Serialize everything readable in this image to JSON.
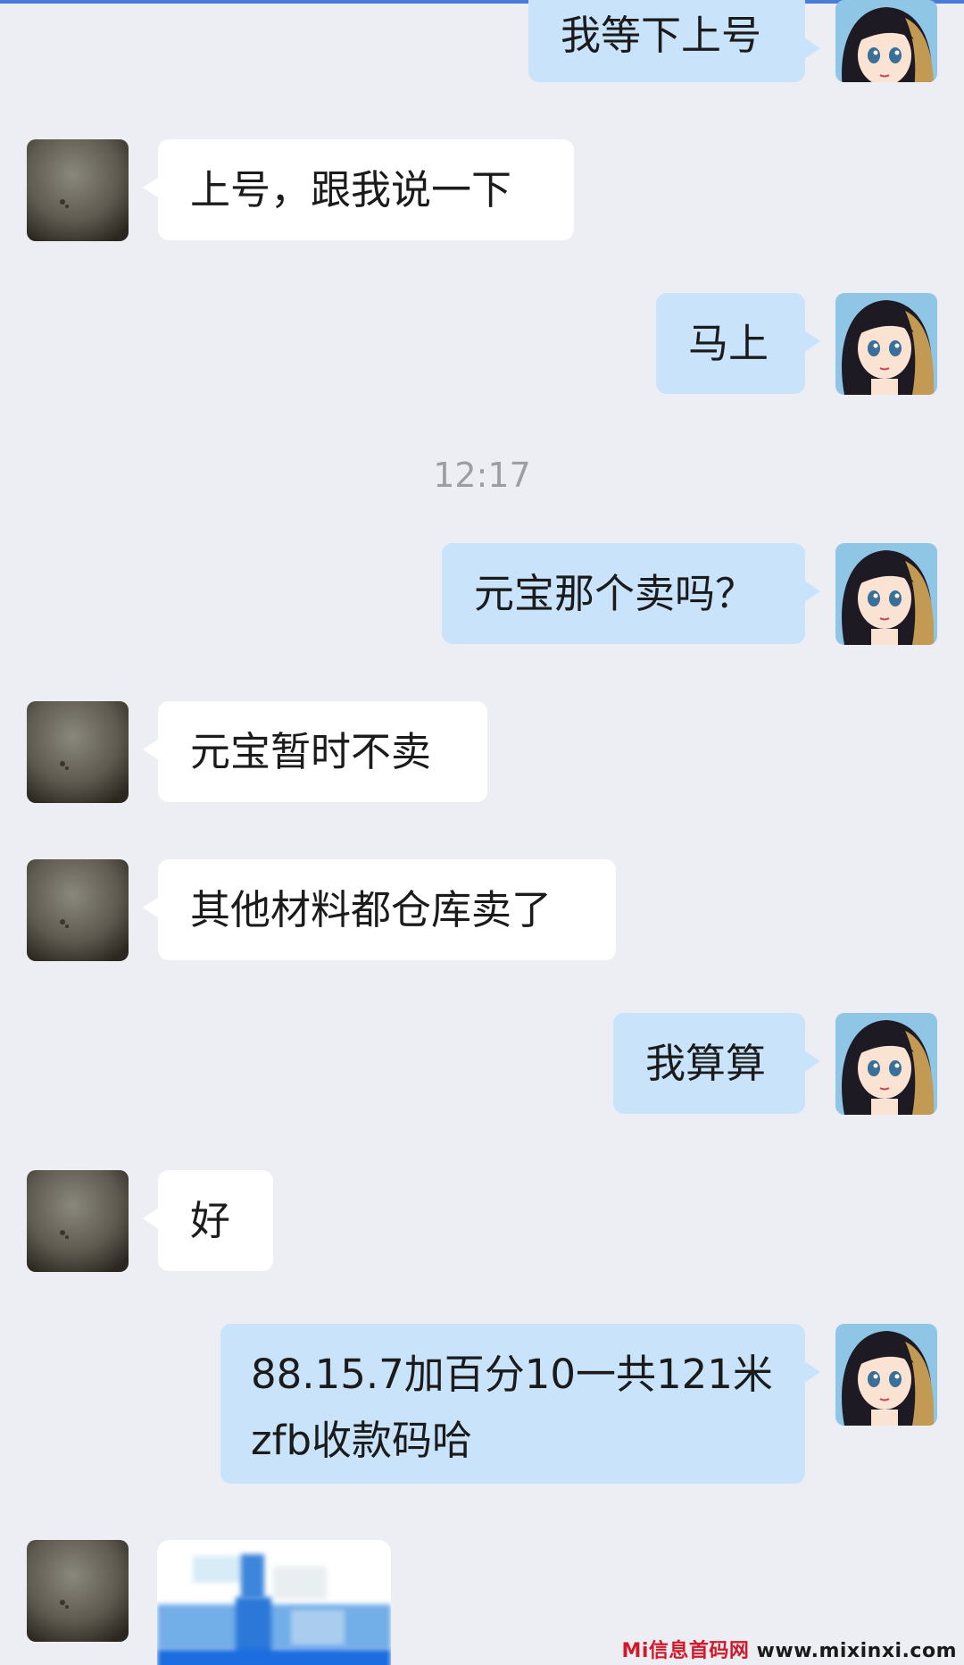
{
  "messages": [
    {
      "side": "me",
      "text": "我等下上号"
    },
    {
      "side": "peer",
      "text": "上号，跟我说一下"
    },
    {
      "side": "me",
      "text": "马上"
    },
    {
      "side": "me",
      "text": "元宝那个卖吗？"
    },
    {
      "side": "peer",
      "text": "元宝暂时不卖"
    },
    {
      "side": "peer",
      "text": "其他材料都仓库卖了"
    },
    {
      "side": "me",
      "text": "我算算"
    },
    {
      "side": "peer",
      "text": "好"
    },
    {
      "side": "me",
      "line1": "88.15.7加百分10一共121米",
      "line2": "zfb收款码哈"
    }
  ],
  "timestamp": "12:17",
  "watermark": {
    "brand": "Mi信息首码网",
    "url": "www.mixinxi.com"
  },
  "colors": {
    "background": "#edeef3",
    "my_bubble": "#c9e3fb",
    "peer_bubble": "#ffffff",
    "timestamp": "#9b9ea5"
  },
  "icons": {
    "my_avatar": "anime-girl-avatar",
    "peer_avatar": "dark-photo-avatar"
  }
}
